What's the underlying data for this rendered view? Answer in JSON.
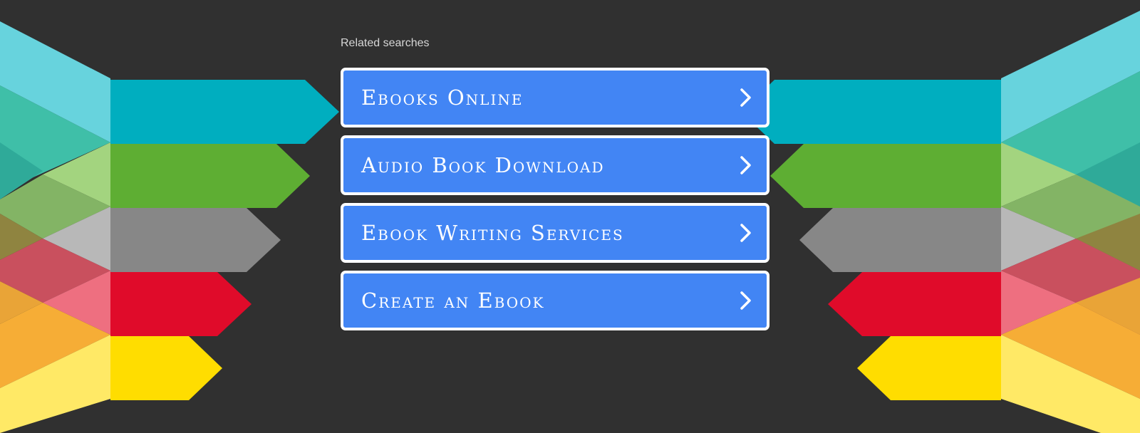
{
  "section_label": "Related searches",
  "links": [
    {
      "label": "Ebooks Online",
      "icon": "chevron-right-icon"
    },
    {
      "label": "Audio Book Download",
      "icon": "chevron-right-icon"
    },
    {
      "label": "Ebook Writing Services",
      "icon": "chevron-right-icon"
    },
    {
      "label": "Create an Ebook",
      "icon": "chevron-right-icon"
    }
  ],
  "colors": {
    "background": "#303030",
    "button": "#4285f4",
    "button_border": "#ffffff",
    "arrow_teal": "#00aebf",
    "arrow_green": "#5eae33",
    "arrow_gray": "#878787",
    "arrow_red": "#e00b2a",
    "arrow_yellow": "#ffdd00"
  }
}
